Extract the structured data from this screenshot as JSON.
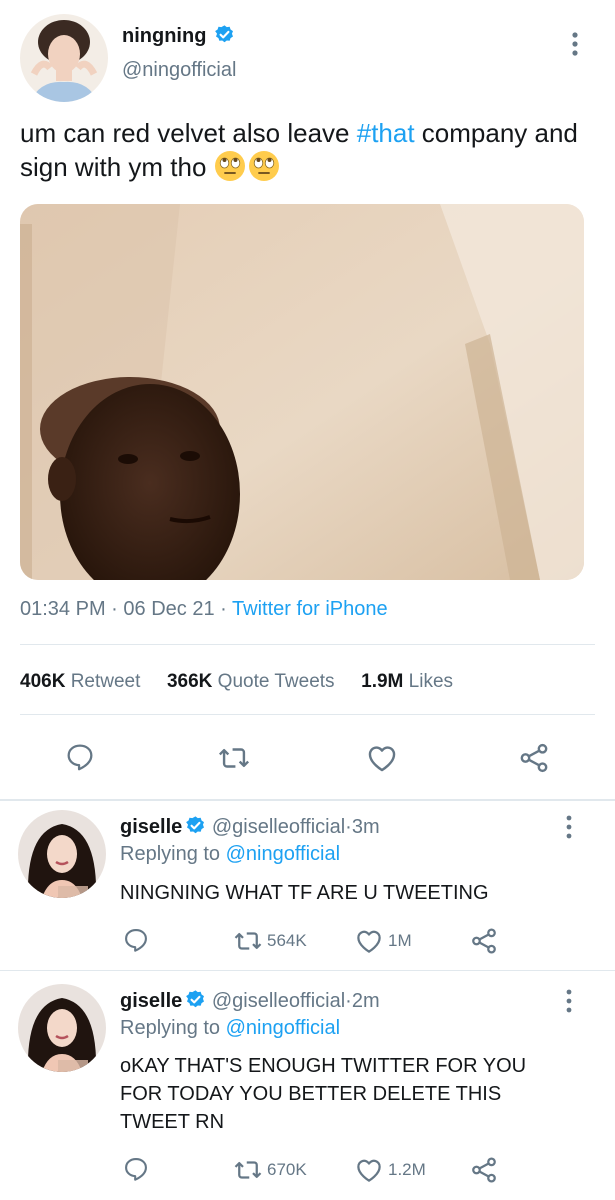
{
  "main_tweet": {
    "display_name": "ningning",
    "handle": "@ningofficial",
    "text_before": "um can red velvet also leave ",
    "hashtag": "#that",
    "text_after": " company and sign with ym tho",
    "emoji": "🙄🙄",
    "time": "01:34 PM",
    "date": "06 Dec 21",
    "source": "Twitter for iPhone",
    "separator": "·",
    "stats": {
      "retweets": "406K",
      "retweets_label": "Retweet",
      "quotes": "366K",
      "quotes_label": "Quote Tweets",
      "likes": "1.9M",
      "likes_label": "Likes"
    },
    "icons": [
      "comment-icon",
      "retweet-icon",
      "heart-icon",
      "share-icon"
    ]
  },
  "replies": [
    {
      "display_name": "giselle",
      "handle": "@giselleofficial",
      "time": "3m",
      "replying_label": "Replying to",
      "replying_to": "@ningofficial",
      "text": "NINGNING WHAT TF ARE U TWEETING",
      "retweets": "564K",
      "likes": "1M"
    },
    {
      "display_name": "giselle",
      "handle": "@giselleofficial",
      "time": "2m",
      "replying_label": "Replying to",
      "replying_to": "@ningofficial",
      "text": "oKAY THAT'S ENOUGH TWITTER FOR YOU FOR TODAY YOU BETTER DELETE THIS TWEET RN",
      "retweets": "670K",
      "likes": "1.2M"
    }
  ],
  "colors": {
    "accent": "#1da1f2",
    "muted": "#657786",
    "text": "#14171a",
    "divider": "#e1e8ed"
  }
}
